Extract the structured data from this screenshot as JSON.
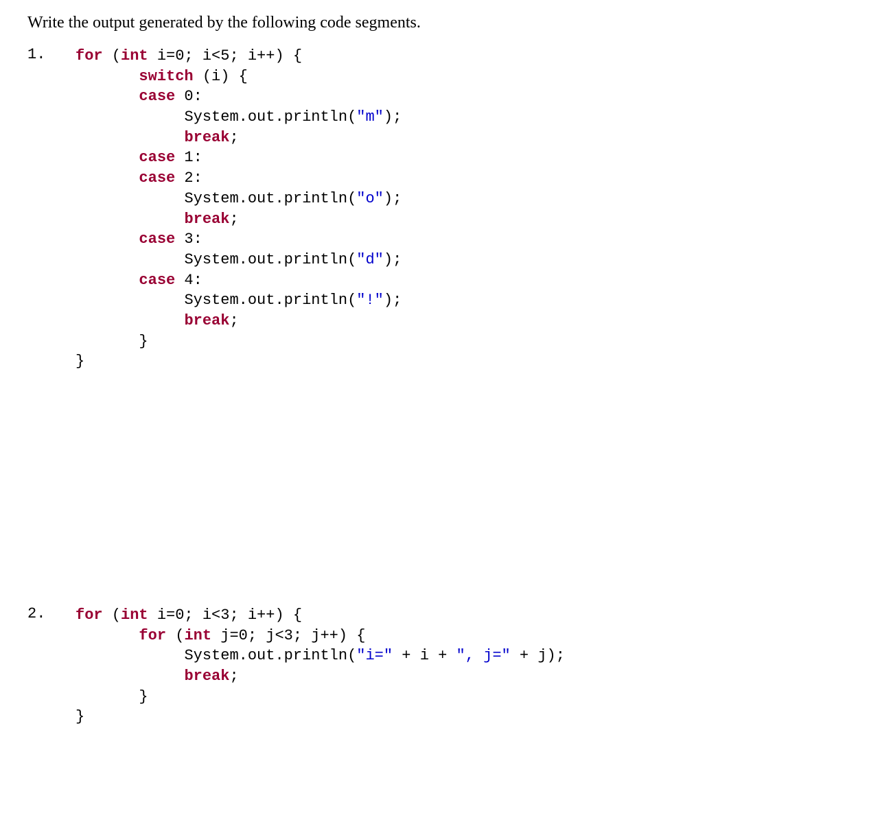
{
  "instruction": "Write the output generated by the following code segments.",
  "problems": [
    {
      "number": "1.",
      "code": {
        "line1_kw1": "for",
        "line1_rest1": " (",
        "line1_kw2": "int",
        "line1_rest2": " i=0; i<5; i++) {",
        "line2_indent": "       ",
        "line2_kw": "switch",
        "line2_rest": " (i) {",
        "line3_indent": "       ",
        "line3_kw": "case",
        "line3_rest": " 0:",
        "line4_indent": "            ",
        "line4_text": "System.out.println(",
        "line4_str": "\"m\"",
        "line4_end": ");",
        "line5_indent": "            ",
        "line5_kw": "break",
        "line5_end": ";",
        "line6_indent": "       ",
        "line6_kw": "case",
        "line6_rest": " 1:",
        "line7_indent": "       ",
        "line7_kw": "case",
        "line7_rest": " 2:",
        "line8_indent": "            ",
        "line8_text": "System.out.println(",
        "line8_str": "\"o\"",
        "line8_end": ");",
        "line9_indent": "            ",
        "line9_kw": "break",
        "line9_end": ";",
        "line10_indent": "       ",
        "line10_kw": "case",
        "line10_rest": " 3:",
        "line11_indent": "            ",
        "line11_text": "System.out.println(",
        "line11_str": "\"d\"",
        "line11_end": ");",
        "line12_indent": "       ",
        "line12_kw": "case",
        "line12_rest": " 4:",
        "line13_indent": "            ",
        "line13_text": "System.out.println(",
        "line13_str": "\"!\"",
        "line13_end": ");",
        "line14_indent": "            ",
        "line14_kw": "break",
        "line14_end": ";",
        "line15_indent": "       ",
        "line15_text": "}",
        "line16_text": "}"
      }
    },
    {
      "number": "2.",
      "code": {
        "line1_kw1": "for",
        "line1_rest1": " (",
        "line1_kw2": "int",
        "line1_rest2": " i=0; i<3; i++) {",
        "line2_indent": "       ",
        "line2_kw1": "for",
        "line2_rest1": " (",
        "line2_kw2": "int",
        "line2_rest2": " j=0; j<3; j++) {",
        "line3_indent": "            ",
        "line3_text": "System.out.println(",
        "line3_str1": "\"i=\"",
        "line3_mid1": " + i + ",
        "line3_str2": "\", j=\"",
        "line3_mid2": " + j);",
        "line4_indent": "            ",
        "line4_kw": "break",
        "line4_end": ";",
        "line5_indent": "       ",
        "line5_text": "}",
        "line6_text": "}"
      }
    }
  ]
}
